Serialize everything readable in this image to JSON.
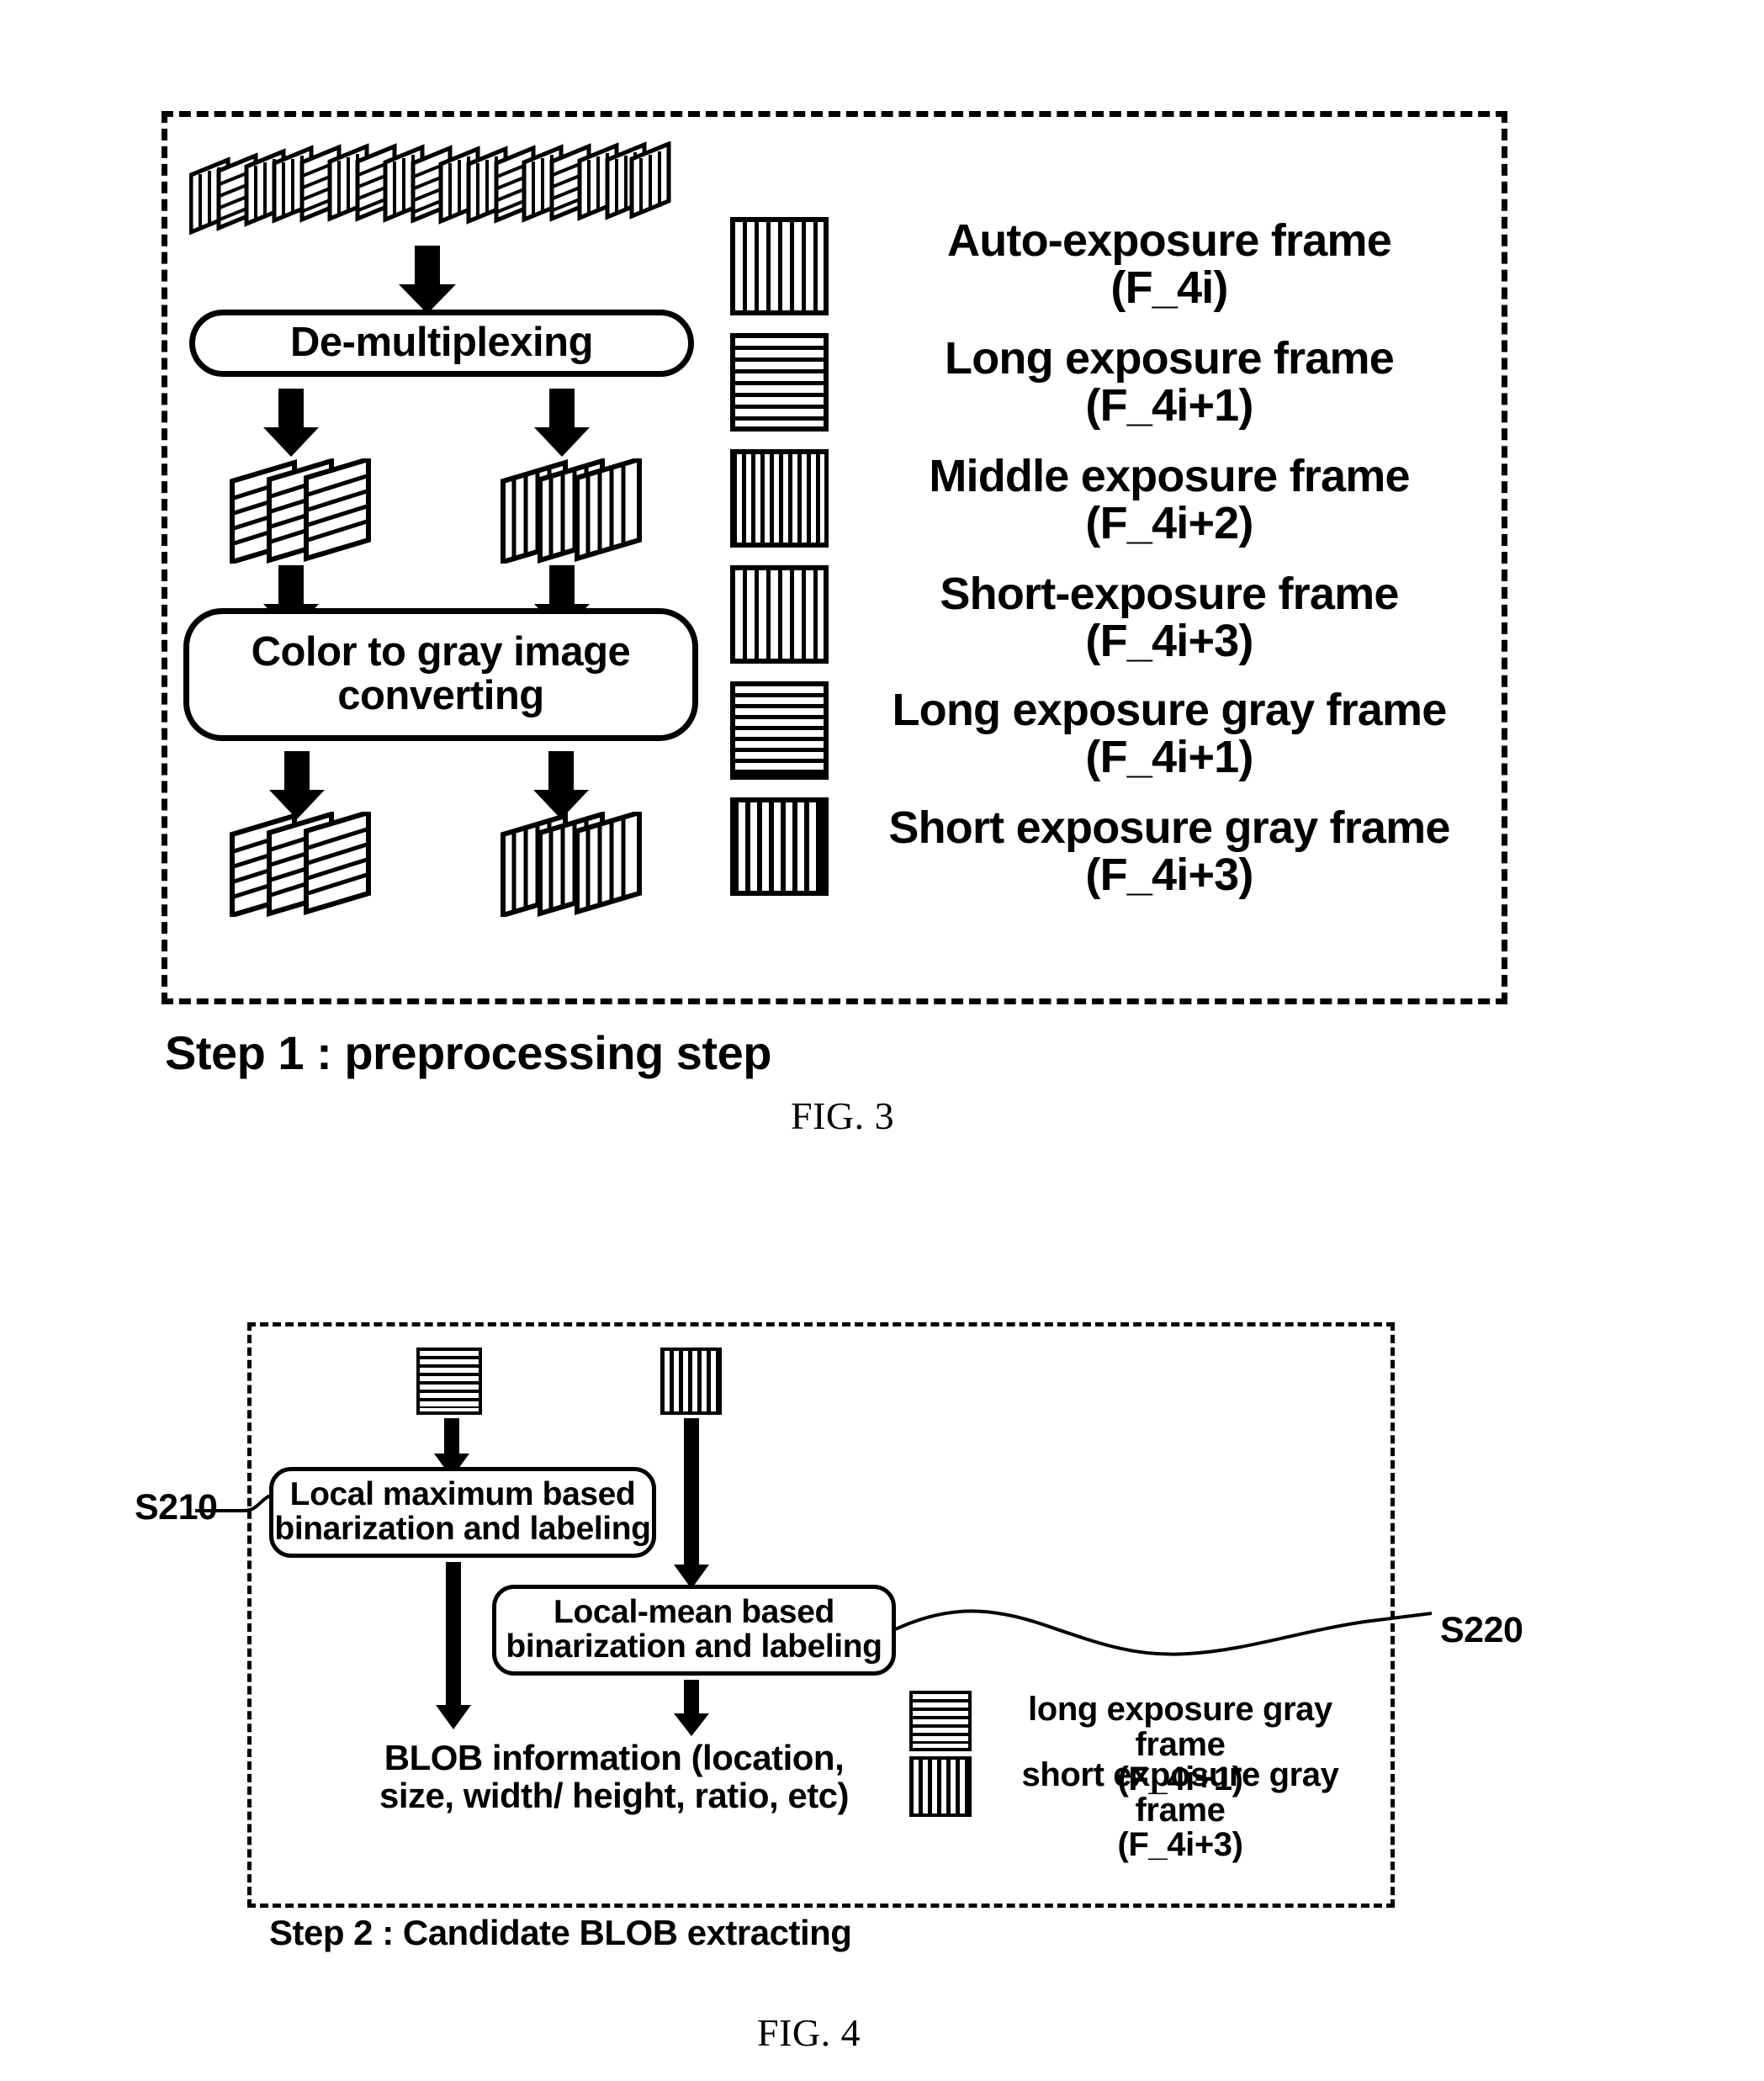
{
  "figure3": {
    "process_boxes": [
      {
        "id": "demultiplexing",
        "label": "De-multiplexing"
      },
      {
        "id": "color-to-gray",
        "label": "Color to gray image\nconverting"
      }
    ],
    "legend": [
      {
        "pattern": "vertical-stripes-wide",
        "label": "Auto-exposure frame\n(F_4i)"
      },
      {
        "pattern": "horizontal-stripes",
        "label": "Long exposure frame\n(F_4i+1)"
      },
      {
        "pattern": "vertical-stripes-dense",
        "label": "Middle exposure frame\n(F_4i+2)"
      },
      {
        "pattern": "vertical-stripes-wide",
        "label": "Short-exposure frame\n(F_4i+3)"
      },
      {
        "pattern": "horizontal-stripes",
        "label": "Long exposure gray frame\n(F_4i+1)"
      },
      {
        "pattern": "vertical-stripes-dense",
        "label": "Short exposure gray frame\n(F_4i+3)"
      }
    ],
    "step_caption": "Step 1 : preprocessing step",
    "fig_caption": "FIG. 3"
  },
  "figure4": {
    "frames_top": [
      {
        "pattern": "horizontal-stripes",
        "name": "long-exposure-gray-frame"
      },
      {
        "pattern": "vertical-stripes-dense",
        "name": "short-exposure-gray-frame"
      }
    ],
    "process_boxes": [
      {
        "id": "local-maximum",
        "label": "Local maximum based\nbinarization and labeling"
      },
      {
        "id": "local-mean",
        "label": "Local-mean based\nbinarization and labeling"
      }
    ],
    "step_refs": [
      {
        "id": "s210",
        "label": "S210"
      },
      {
        "id": "s220",
        "label": "S220"
      }
    ],
    "output_label": "BLOB information (location,\nsize, width/ height, ratio, etc)",
    "legend": [
      {
        "pattern": "horizontal-stripes",
        "label": "long exposure gray frame\n(F_4i+1)"
      },
      {
        "pattern": "vertical-stripes-dense",
        "label": "short exposure gray frame\n(F_4i+3)"
      }
    ],
    "step_caption": "Step 2 : Candidate BLOB extracting",
    "fig_caption": "FIG. 4"
  },
  "colors": {
    "ink": "#000000",
    "paper": "#ffffff"
  }
}
